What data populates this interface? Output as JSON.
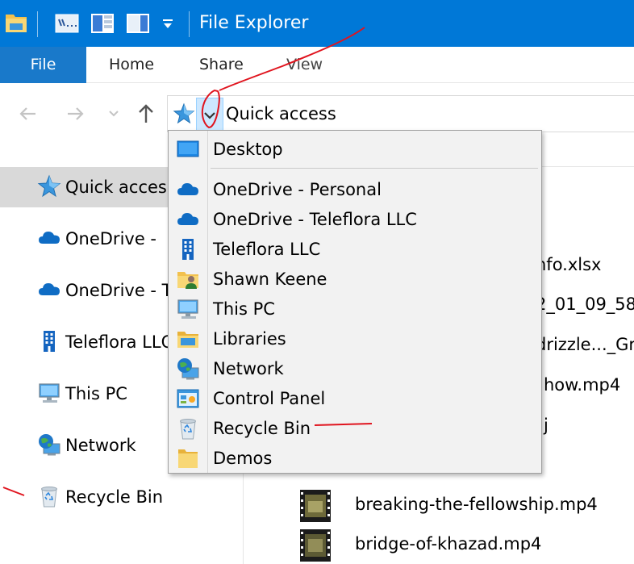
{
  "window": {
    "title": "File Explorer"
  },
  "ribbon": {
    "tabs": [
      {
        "label": "File",
        "active": true
      },
      {
        "label": "Home"
      },
      {
        "label": "Share"
      },
      {
        "label": "View"
      }
    ]
  },
  "address_bar": {
    "location": "Quick access"
  },
  "nav_pane": {
    "items": [
      {
        "label": "Quick access",
        "icon": "star-icon",
        "selected": true
      },
      {
        "label": "OneDrive -",
        "icon": "cloud-icon"
      },
      {
        "label": "OneDrive - T",
        "icon": "cloud-icon"
      },
      {
        "label": "Teleflora LLC",
        "icon": "building-icon"
      },
      {
        "label": "This PC",
        "icon": "computer-icon"
      },
      {
        "label": "Network",
        "icon": "network-icon"
      },
      {
        "label": "Recycle Bin",
        "icon": "recycle-bin-icon"
      }
    ]
  },
  "file_list": {
    "partial_names": [
      "nfo.xlsx",
      "2_01_09_58",
      "drizzle..._Gr",
      "how.mp4",
      "j"
    ],
    "rows": [
      {
        "name": "breaking-the-fellowship.mp4",
        "icon": "video-thumbnail-icon"
      },
      {
        "name": "bridge-of-khazad.mp4",
        "icon": "video-thumbnail-icon"
      }
    ]
  },
  "dropdown": {
    "items": [
      {
        "label": "Desktop",
        "icon": "desktop-icon"
      },
      {
        "label": "OneDrive - Personal",
        "icon": "cloud-icon"
      },
      {
        "label": "OneDrive - Teleflora LLC",
        "icon": "cloud-icon"
      },
      {
        "label": "Teleflora LLC",
        "icon": "building-icon"
      },
      {
        "label": "Shawn Keene",
        "icon": "user-folder-icon"
      },
      {
        "label": "This PC",
        "icon": "computer-icon"
      },
      {
        "label": "Libraries",
        "icon": "libraries-icon"
      },
      {
        "label": "Network",
        "icon": "network-icon"
      },
      {
        "label": "Control Panel",
        "icon": "control-panel-icon"
      },
      {
        "label": "Recycle Bin",
        "icon": "recycle-bin-icon"
      },
      {
        "label": "Demos",
        "icon": "folder-icon"
      }
    ]
  },
  "colors": {
    "titlebar": "#0078d7",
    "file_tab": "#1979ca",
    "selection": "#d9d9d9",
    "annotation": "#e0141e"
  }
}
